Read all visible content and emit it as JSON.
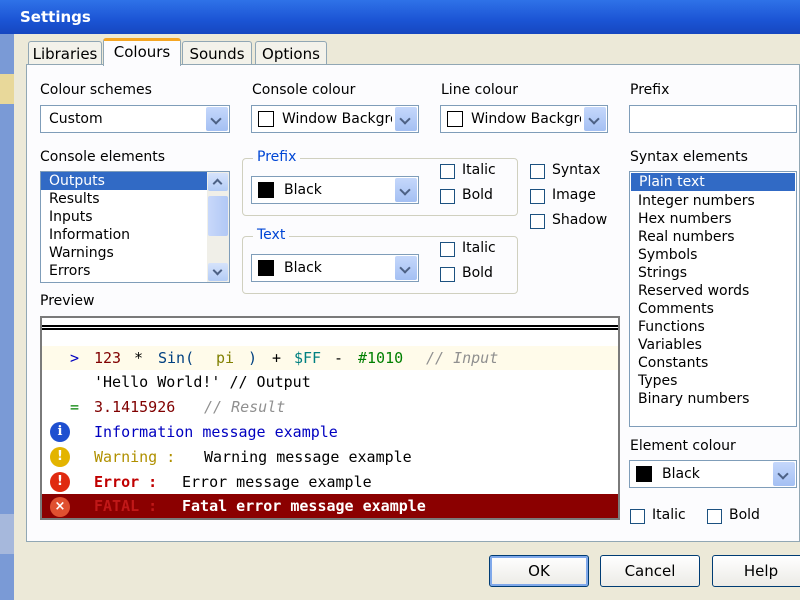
{
  "window": {
    "title": "Settings"
  },
  "tabs": [
    {
      "label": "Libraries",
      "active": false
    },
    {
      "label": "Colours",
      "active": true
    },
    {
      "label": "Sounds",
      "active": false
    },
    {
      "label": "Options",
      "active": false
    }
  ],
  "colour_schemes": {
    "label": "Colour schemes",
    "value": "Custom"
  },
  "console_colour": {
    "label": "Console colour",
    "value": "Window Background",
    "swatch": "#ffffff"
  },
  "line_colour": {
    "label": "Line colour",
    "value": "Window Background",
    "swatch": "#ffffff"
  },
  "prefix_field": {
    "label": "Prefix",
    "value": ""
  },
  "console_elements": {
    "label": "Console elements",
    "items": [
      "Outputs",
      "Results",
      "Inputs",
      "Information",
      "Warnings",
      "Errors"
    ],
    "selected": "Outputs"
  },
  "prefix_group": {
    "label": "Prefix",
    "colour": "Black",
    "swatch": "#000000",
    "italic": "Italic",
    "bold": "Bold"
  },
  "text_group": {
    "label": "Text",
    "colour": "Black",
    "swatch": "#000000",
    "italic": "Italic",
    "bold": "Bold"
  },
  "syntax_options": [
    "Syntax",
    "Image",
    "Shadow"
  ],
  "syntax_elements": {
    "label": "Syntax elements",
    "items": [
      "Plain text",
      "Integer numbers",
      "Hex numbers",
      "Real numbers",
      "Symbols",
      "Strings",
      "Reserved words",
      "Comments",
      "Functions",
      "Variables",
      "Constants",
      "Types",
      "Binary numbers"
    ],
    "selected": "Plain text"
  },
  "element_colour": {
    "label": "Element colour",
    "value": "Black",
    "swatch": "#000000",
    "italic": "Italic",
    "bold": "Bold"
  },
  "preview": {
    "label": "Preview",
    "input_line": {
      "prompt": ">",
      "num": "123",
      "op1": "*",
      "func": "Sin(",
      "var": "pi",
      "paren": ")",
      "op2": "+",
      "hex": "$FF",
      "op3": "-",
      "bin": "#1010",
      "comment": "// Input"
    },
    "output_line": {
      "text": "'Hello World!' // Output"
    },
    "result_line": {
      "prompt": "=",
      "value": "3.1415926",
      "comment": "// Result"
    },
    "info_line": {
      "icon": "i",
      "text": "Information message example"
    },
    "warning_line": {
      "icon": "!",
      "prefix": "Warning :",
      "text": "Warning message example"
    },
    "error_line": {
      "icon": "!",
      "prefix": "Error :",
      "text": "Error message example"
    },
    "fatal_line": {
      "icon": "×",
      "prefix": "FATAL :",
      "text": "Fatal error message example"
    }
  },
  "buttons": {
    "ok": "OK",
    "cancel": "Cancel",
    "help": "Help"
  }
}
